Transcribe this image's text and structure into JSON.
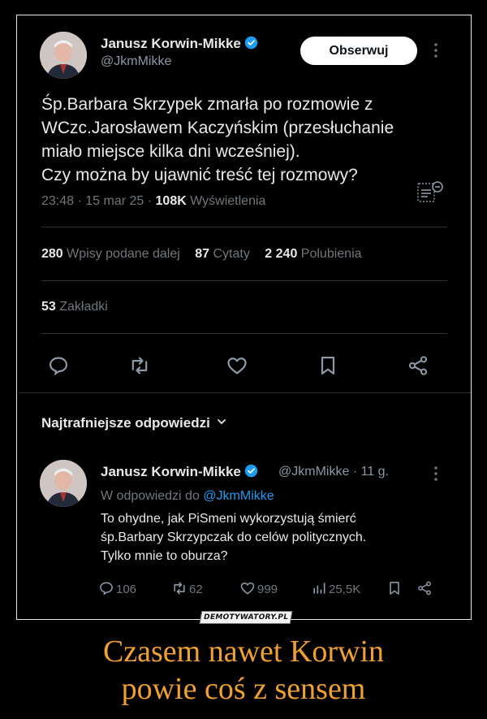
{
  "tweet": {
    "author_name": "Janusz Korwin-Mikke",
    "handle": "@JkmMikke",
    "follow_label": "Obserwuj",
    "text": "Śp.Barbara Skrzypek zmarła po rozmowie z\nWCzc.Jarosławem Kaczyńskim (przesłuchanie\nmiało miejsce kilka dni wcześniej).\nCzy można by ujawnić treść tej rozmowy?",
    "time": "23:48 · 15 mar 25 · ",
    "views_count": "108K",
    "views_label": " Wyświetlenia"
  },
  "stats": {
    "reposts_count": "280",
    "reposts_label": "Wpisy podane dalej",
    "quotes_count": "87",
    "quotes_label": "Cytaty",
    "likes_count": "2 240",
    "likes_label": "Polubienia",
    "bookmarks_count": "53",
    "bookmarks_label": "Zakładki"
  },
  "replies_section": {
    "title": "Najtrafniejsze odpowiedzi"
  },
  "reply": {
    "author_name": "Janusz Korwin-Mikke",
    "handle_time": "@JkmMikke · 11 g.",
    "reply_to_prefix": "W odpowiedzi do ",
    "reply_to_mention": "@JkmMikke",
    "text": "To ohydne, jak PiSmeni wykorzystują śmierć\nśp.Barbary Skrzypczak do celów politycznych.\nTylko mnie to oburza?",
    "replies": "106",
    "reposts": "62",
    "likes": "999",
    "views": "25,5K"
  },
  "watermark": "DEMOTYWATORY.PL",
  "caption": {
    "line1": "Czasem nawet Korwin",
    "line2": "powie coś z sensem"
  },
  "colors": {
    "background": "#000000",
    "text": "#e7e9ea",
    "muted": "#71767b",
    "link": "#1d9bf0",
    "caption": "#f0a030"
  }
}
